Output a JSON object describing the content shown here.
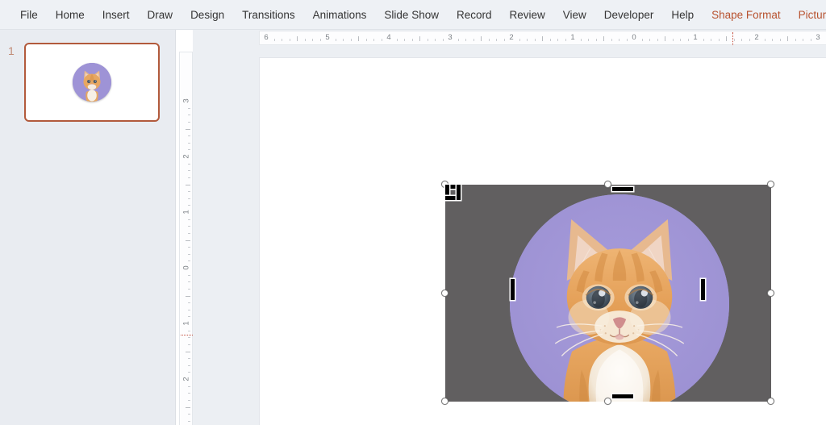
{
  "app": {
    "name": "PowerPoint",
    "accent_color": "#b8522f",
    "menubar_bg": "#eef1f5",
    "pane_bg": "#e9ecf1",
    "canvas_bg": "#ffffff"
  },
  "menubar": {
    "items": [
      {
        "label": "File",
        "contextual": false
      },
      {
        "label": "Home",
        "contextual": false
      },
      {
        "label": "Insert",
        "contextual": false
      },
      {
        "label": "Draw",
        "contextual": false
      },
      {
        "label": "Design",
        "contextual": false
      },
      {
        "label": "Transitions",
        "contextual": false
      },
      {
        "label": "Animations",
        "contextual": false
      },
      {
        "label": "Slide Show",
        "contextual": false
      },
      {
        "label": "Record",
        "contextual": false
      },
      {
        "label": "Review",
        "contextual": false
      },
      {
        "label": "View",
        "contextual": false
      },
      {
        "label": "Developer",
        "contextual": false
      },
      {
        "label": "Help",
        "contextual": false
      },
      {
        "label": "Shape Format",
        "contextual": true
      },
      {
        "label": "Picture Format",
        "contextual": true
      }
    ]
  },
  "thumbnail_pane": {
    "slides": [
      {
        "number": "1",
        "selected": true,
        "content_description": "kitten-circle-image"
      }
    ],
    "selection_border_color": "#b25a3c"
  },
  "rulers": {
    "horizontal": {
      "unit": "inches",
      "labels": [
        "6",
        "5",
        "4",
        "3",
        "2",
        "1",
        "0",
        "1",
        "2",
        "3"
      ],
      "marker_position_label": "1.6"
    },
    "vertical": {
      "unit": "inches",
      "labels": [
        "3",
        "2",
        "1",
        "0",
        "1",
        "2"
      ],
      "marker_position_label": "1.2"
    }
  },
  "slide_object": {
    "type": "picture",
    "state": "cropping",
    "shape": "oval",
    "overlay_color": "#615F60",
    "image": {
      "subject": "orange tabby kitten",
      "background_color": "#9e93d6",
      "fur_color": "#e09a52",
      "eye_color": "#5c6773",
      "nose_color": "#d28c8c"
    },
    "resize_handles": [
      "top-left",
      "top-center",
      "top-right",
      "middle-left",
      "middle-right",
      "bottom-left",
      "bottom-center",
      "bottom-right"
    ],
    "crop_handles": [
      "crop-top-left",
      "crop-top-center",
      "crop-top-right",
      "crop-middle-left",
      "crop-middle-right",
      "crop-bottom-left",
      "crop-bottom-center",
      "crop-bottom-right"
    ]
  }
}
